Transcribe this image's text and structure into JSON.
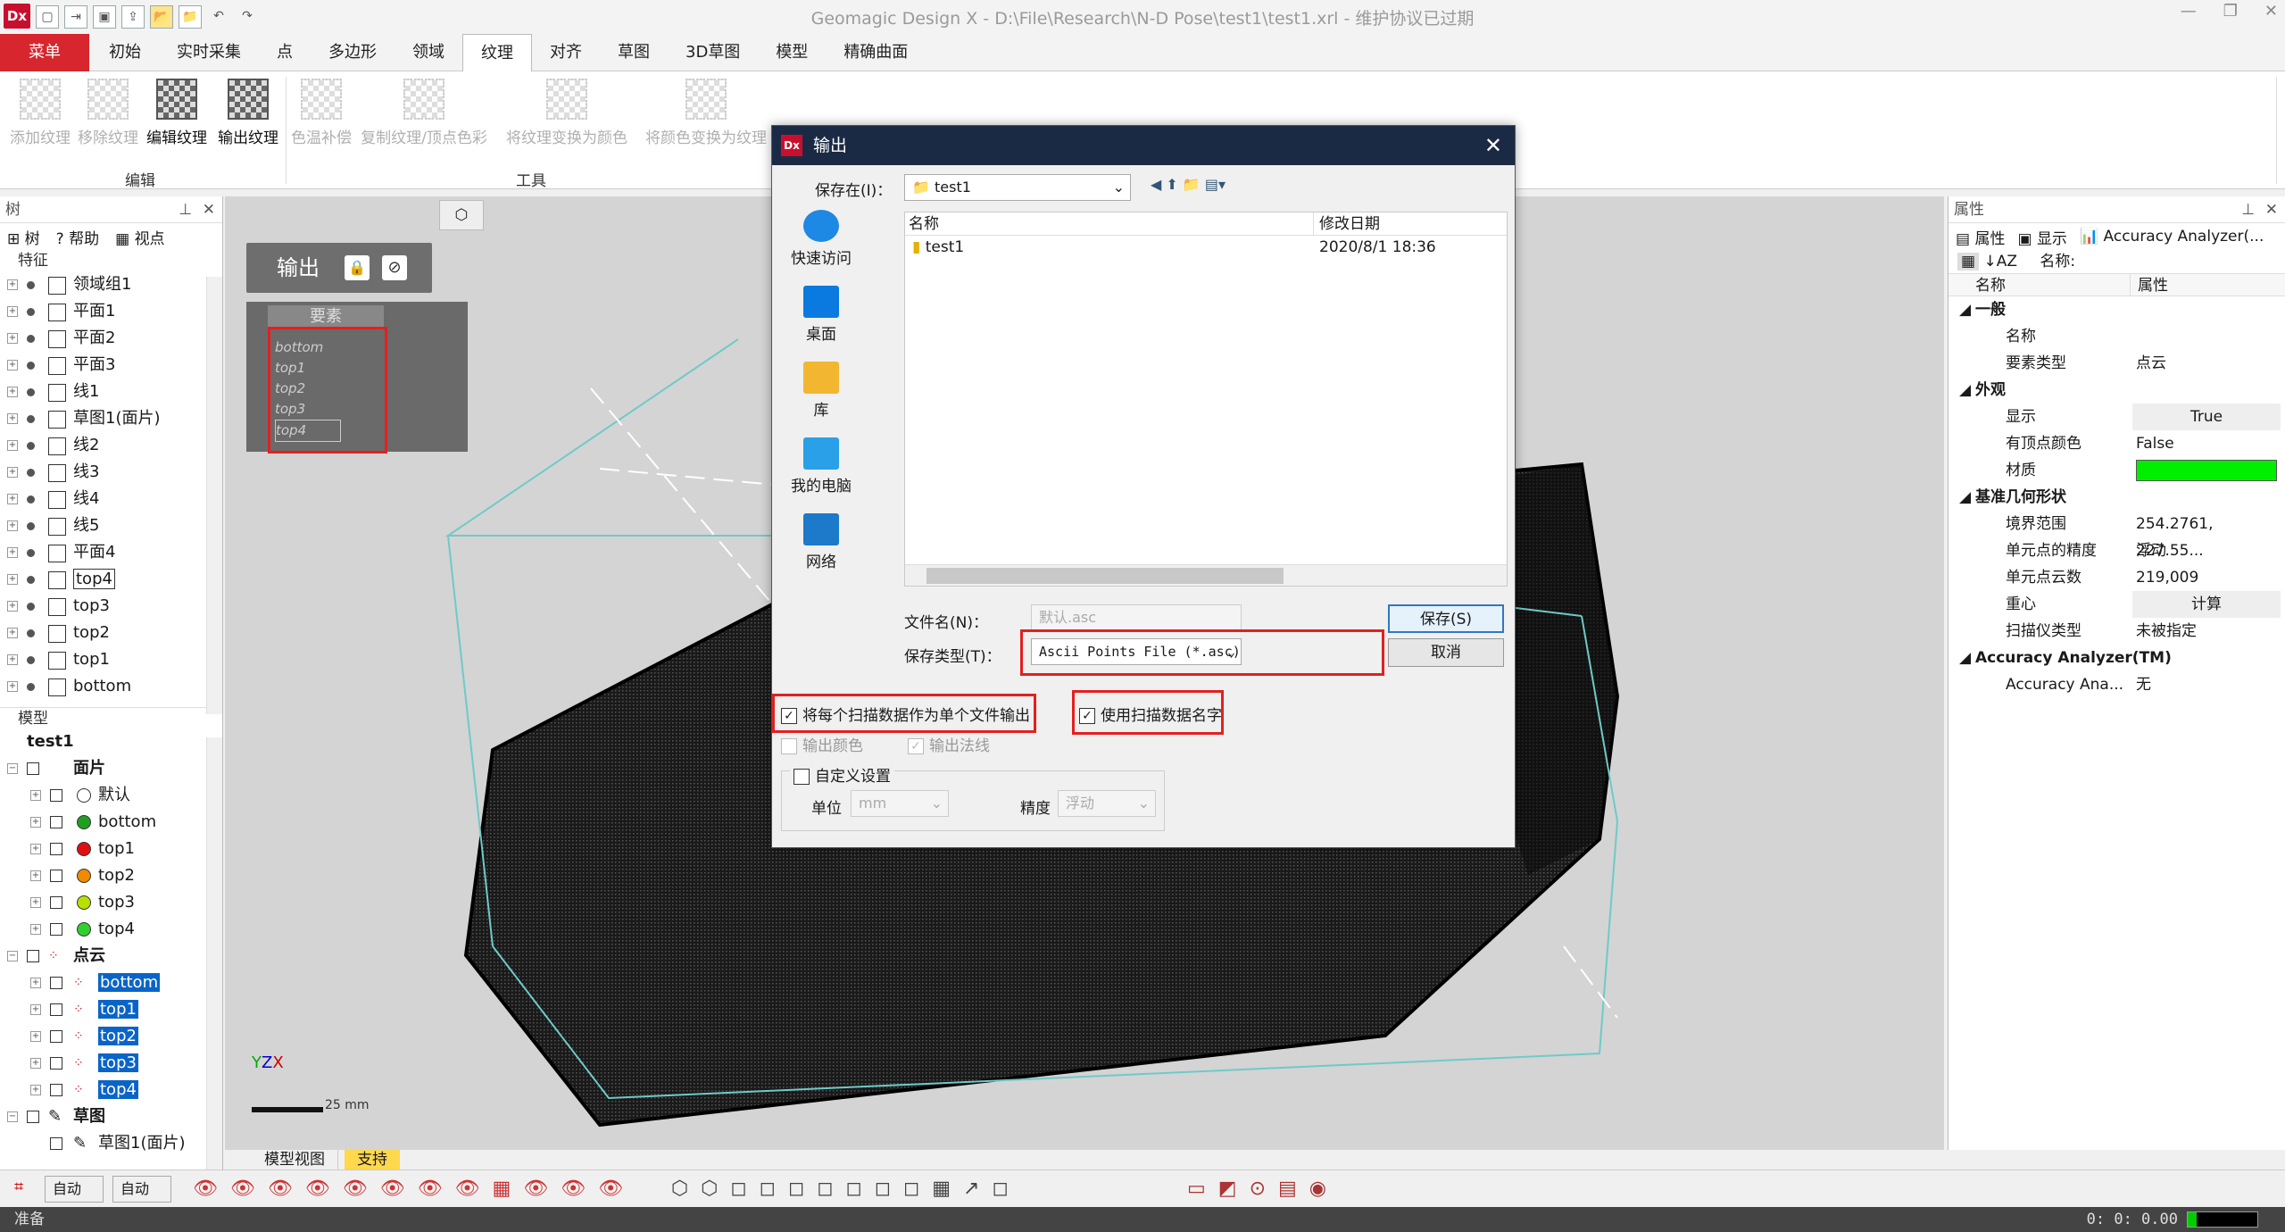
{
  "window": {
    "title": "Geomagic Design X - D:\\File\\Research\\N-D Pose\\test1\\test1.xrl - 维护协议已过期",
    "logo_text": "Dx"
  },
  "menu": {
    "main_label": "菜单",
    "tabs": [
      "初始",
      "实时采集",
      "点",
      "多边形",
      "领域",
      "纹理",
      "对齐",
      "草图",
      "3D草图",
      "模型",
      "精确曲面"
    ],
    "active_tab": "纹理"
  },
  "ribbon": {
    "buttons": [
      {
        "label": "添加纹理",
        "enabled": false
      },
      {
        "label": "移除纹理",
        "enabled": false
      },
      {
        "label": "编辑纹理",
        "enabled": true
      },
      {
        "label": "输出纹理",
        "enabled": true
      },
      {
        "label": "色温补偿",
        "enabled": false
      },
      {
        "label": "复制纹理/顶点色彩",
        "enabled": false
      },
      {
        "label": "将纹理变换为颜色",
        "enabled": false
      },
      {
        "label": "将颜色变换为纹理",
        "enabled": false
      }
    ],
    "groups": [
      "编辑",
      "工具"
    ]
  },
  "tree_panel": {
    "title": "树",
    "tabs": [
      "树",
      "帮助",
      "视点"
    ],
    "features_label": "特征",
    "features": [
      "领域组1",
      "平面1",
      "平面2",
      "平面3",
      "线1",
      "草图1(面片)",
      "线2",
      "线3",
      "线4",
      "线5",
      "平面4",
      "top4",
      "top3",
      "top2",
      "top1",
      "bottom"
    ],
    "model_label": "模型",
    "model_root": "test1",
    "mesh_label": "面片",
    "mesh_items": [
      {
        "label": "默认",
        "color": "#ffffff"
      },
      {
        "label": "bottom",
        "color": "#20a020"
      },
      {
        "label": "top1",
        "color": "#e01010"
      },
      {
        "label": "top2",
        "color": "#f08a00"
      },
      {
        "label": "top3",
        "color": "#b8e000"
      },
      {
        "label": "top4",
        "color": "#30d030"
      }
    ],
    "pointcloud_label": "点云",
    "pointcloud_items": [
      "bottom",
      "top1",
      "top2",
      "top3",
      "top4"
    ],
    "sketch_label": "草图",
    "sketch_items": [
      "草图1(面片)"
    ]
  },
  "viewport": {
    "output_panel_title": "输出",
    "elements_header": "要素",
    "elements": [
      "bottom",
      "top1",
      "top2",
      "top3",
      "top4"
    ],
    "scale_label": "25 mm",
    "tabs": [
      "模型视图",
      "支持"
    ]
  },
  "dialog": {
    "title": "输出",
    "save_in_label": "保存在(I)：",
    "save_in_value": "test1",
    "places": [
      "快速访问",
      "桌面",
      "库",
      "我的电脑",
      "网络"
    ],
    "columns": [
      "名称",
      "修改日期"
    ],
    "files": [
      {
        "name": "test1",
        "date": "2020/8/1 18:36"
      }
    ],
    "filename_label": "文件名(N)：",
    "filename_value": "默认.asc",
    "filetype_label": "保存类型(T)：",
    "filetype_value": "Ascii Points File (*.asc)",
    "save_button": "保存(S)",
    "cancel_button": "取消",
    "option_each_scan": "将每个扫描数据作为单个文件输出",
    "option_use_scan_name": "使用扫描数据名字",
    "option_output_color": "输出颜色",
    "option_output_normals": "输出法线",
    "option_custom": "自定义设置",
    "unit_label": "单位",
    "unit_value": "mm",
    "precision_label": "精度",
    "precision_value": "浮动"
  },
  "properties": {
    "title": "属性",
    "tabs": [
      "属性",
      "显示",
      "Accuracy Analyzer(..."
    ],
    "name_field_label": "名称:",
    "col_name": "名称",
    "col_prop": "属性",
    "groups": [
      {
        "title": "一般",
        "rows": [
          {
            "k": "名称",
            "v": ""
          },
          {
            "k": "要素类型",
            "v": "点云"
          }
        ]
      },
      {
        "title": "外观",
        "rows": [
          {
            "k": "显示",
            "v": "True"
          },
          {
            "k": "有顶点颜色",
            "v": "False"
          },
          {
            "k": "材质",
            "v": ""
          }
        ]
      },
      {
        "title": "基准几何形状",
        "rows": [
          {
            "k": "境界范围",
            "v": "254.2761, 227.55..."
          },
          {
            "k": "单元点的精度",
            "v": "浮动"
          },
          {
            "k": "单元点云数",
            "v": "219,009"
          },
          {
            "k": "重心",
            "v": "计算"
          },
          {
            "k": "扫描仪类型",
            "v": "未被指定"
          }
        ]
      },
      {
        "title": "Accuracy Analyzer(TM)",
        "rows": [
          {
            "k": "Accuracy Ana...",
            "v": "无"
          }
        ]
      }
    ],
    "material_color": "#00ee00"
  },
  "toolbar2": {
    "dropdown1": "自动",
    "dropdown2": "自动"
  },
  "status": {
    "left": "准备",
    "right": "0: 0: 0.00"
  }
}
